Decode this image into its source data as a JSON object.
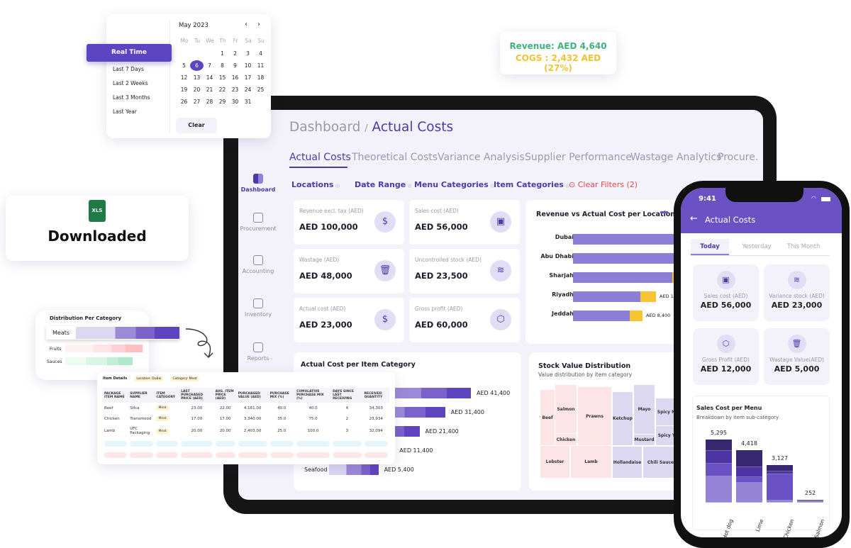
{
  "colors": {
    "accent": "#4b3aa8",
    "revenue": "#3db37a",
    "cogs": "#f3c233",
    "danger": "#e24a4a"
  },
  "tooltip": {
    "revenue": "Revenue: AED 4,640",
    "cogs": "COGS : 2,432 AED (27%)"
  },
  "calendar": {
    "month": "May 2023",
    "prev": "‹",
    "next": "›",
    "weekdays": [
      "Mo",
      "Tu",
      "We",
      "Th",
      "Fr",
      "Sa",
      "Su"
    ],
    "selected": "6",
    "presets": [
      "Real Time",
      "Last 7 Days",
      "Last 2 Weeks",
      "Last 3 Months",
      "Last Year"
    ],
    "active_preset": "Real Time",
    "clear": "Clear"
  },
  "download": {
    "file_badge": "XLS",
    "label": "Downloaded"
  },
  "distribution": {
    "title": "Distribution Per Category",
    "rows": [
      "Meats",
      "Fruits",
      "Sauces"
    ]
  },
  "item_table": {
    "title": "Item Details",
    "location": "Location: Dubai",
    "category": "Category: Meat",
    "headers": [
      "PACKAGE ITEM NAME",
      "SUPPLIER NAME",
      "ITEM CATEGORY",
      "LAST PURCHASED PRICE (AED)",
      "AVG. ITEM PRICE (AED)",
      "PURCHASED VALUE (AED)",
      "PURCHASE MIX (%)",
      "CUMULATIVE PURCHASE MIX (%)",
      "DAYS SINCE LAST RECEIVING",
      "RECEIVED QUANTITY"
    ],
    "rows": [
      [
        "Beef",
        "Sifca",
        "Meat",
        "23.00",
        "22.00",
        "4,161.00",
        "40.0",
        "40.0",
        "4",
        "34,303"
      ],
      [
        "Chicken",
        "Transmood",
        "Meat",
        "17.00",
        "17.00",
        "3,340.00",
        "35.0",
        "75.0",
        "2",
        "23,934"
      ],
      [
        "Lamb",
        "UFC Packaging",
        "Meat",
        "20.00",
        "20.00",
        "2,403.00",
        "25.0",
        "100.0",
        "3",
        "32,094"
      ]
    ]
  },
  "dashboard": {
    "breadcrumb_parent": "Dashboard",
    "breadcrumb_sep": "/",
    "breadcrumb_current": "Actual Costs",
    "sidebar": [
      {
        "label": "Dashboard",
        "icon": "dashboard-icon"
      },
      {
        "label": "Procurement",
        "icon": "cart-icon"
      },
      {
        "label": "Accounting",
        "icon": "calculator-icon"
      },
      {
        "label": "Inventory",
        "icon": "box-icon"
      },
      {
        "label": "Reports",
        "icon": "report-icon"
      }
    ],
    "tabs": [
      "Actual Costs",
      "Theoretical Costs",
      "Variance Analysis",
      "Supplier Performance",
      "Wastage Analytics",
      "Procure."
    ],
    "filters": [
      "Locations",
      "Date Range",
      "Menu Categories",
      "Item Categories"
    ],
    "clear_filters": "Clear Filters (2)",
    "kpis": [
      {
        "label": "Revenue excl. tax (AED)",
        "value": "AED 100,000",
        "icon": "dollar-return-icon"
      },
      {
        "label": "Sales cost (AED)",
        "value": "AED 56,000",
        "icon": "cash-icon"
      },
      {
        "label": "Wastage (AED)",
        "value": "AED 48,000",
        "icon": "trash-icon"
      },
      {
        "label": "Uncontrolled stock (AED)",
        "value": "AED 23,500",
        "icon": "coins-icon"
      },
      {
        "label": "Actual cost (AED)",
        "value": "AED 23,000",
        "icon": "dollar-return-icon"
      },
      {
        "label": "Gross profit (AED)",
        "value": "AED 60,000",
        "icon": "package-icon"
      }
    ]
  },
  "chart_data": [
    {
      "type": "bar",
      "title": "Revenue vs Actual Cost per Location",
      "categories": [
        "Dubai",
        "Abu Dhabi",
        "Sharjah",
        "Riyadh",
        "Jeddah"
      ],
      "data_labels": [
        "",
        "",
        "",
        "AED 1",
        "AED 8,400"
      ]
    },
    {
      "type": "bar",
      "title": "Actual Cost per Item Category",
      "categories": [
        "",
        "",
        "",
        "",
        "Seafood"
      ],
      "values": [
        41400,
        31400,
        21400,
        11400,
        5400
      ],
      "data_labels": [
        "AED 41,400",
        "AED 31,400",
        "AED 21,400",
        "AED 11,400",
        "AED 5,400"
      ]
    },
    {
      "type": "heatmap",
      "title": "Stock Value Distribution",
      "subtitle": "Value distribution by item category",
      "cells": [
        "Beef",
        "Salmon",
        "Chicken",
        "Prawns",
        "Lobster",
        "Lamb",
        "Ketchup",
        "Mayo",
        "Mustard",
        "Spicy M",
        "Spicy Y",
        "Hollandaise",
        "Chili Sauce"
      ]
    },
    {
      "type": "bar",
      "title": "Sales Cost per Menu",
      "subtitle": "Breakdown by item sub-category",
      "categories": [
        "Hot dog",
        "Lime",
        "Chicken",
        "Salmon"
      ],
      "values": [
        5295,
        4418,
        3127,
        252
      ],
      "data_labels": [
        "5,295",
        "4,418",
        "3,127",
        "252"
      ]
    }
  ],
  "phone": {
    "time": "9:41",
    "title": "Actual Costs",
    "back": "←",
    "tabs": [
      "Today",
      "Yesterday",
      "This Month"
    ],
    "kpis": [
      {
        "label": "Sales cost (AED)",
        "value": "AED 56,000",
        "icon": "cash-icon"
      },
      {
        "label": "Variance stock (AED)",
        "value": "AED 23,000",
        "icon": "coins-icon"
      },
      {
        "label": "Gross Profit (AED)",
        "value": "AED 12,000",
        "icon": "package-icon"
      },
      {
        "label": "Wastage Value(AED)",
        "value": "AED 5,000",
        "icon": "trash-icon"
      }
    ]
  }
}
